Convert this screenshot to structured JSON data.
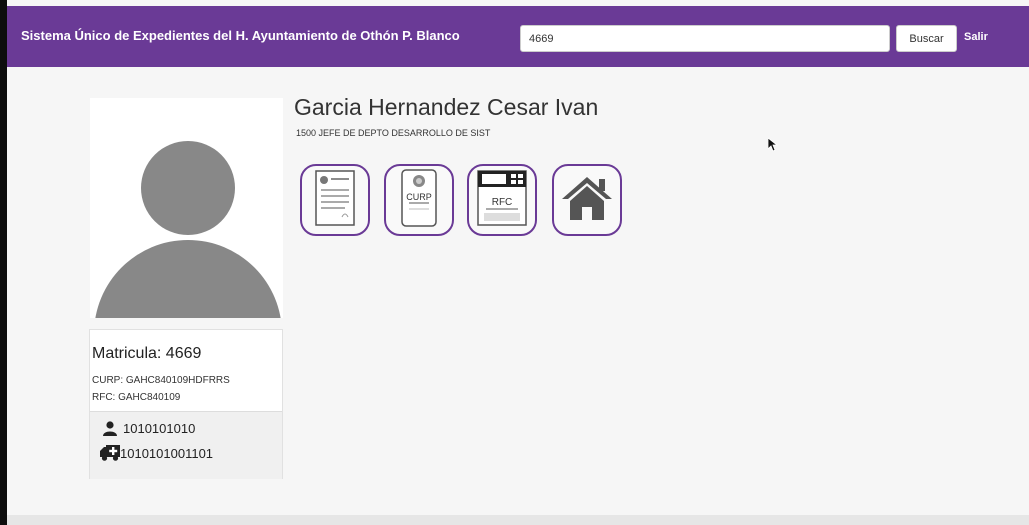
{
  "navbar": {
    "brand": "Sistema Único de Expedientes del H. Ayuntamiento de Othón P. Blanco",
    "search_value": "4669",
    "search_button": "Buscar",
    "logout": "Salir",
    "color": "#6a3a96"
  },
  "profile": {
    "name": "Garcia Hernandez Cesar Ivan",
    "position": "1500 JEFE DE DEPTO DESARROLLO DE SIST",
    "matricula": "Matricula: 4669",
    "curp": "CURP: GAHC840109HDFRRS",
    "rfc": "RFC: GAHC840109",
    "phone_icon": "user-icon",
    "phone": "1010101010",
    "nss_icon": "ambulance-icon",
    "nss": "1010101001101"
  },
  "documents": [
    {
      "icon": "document-icon"
    },
    {
      "icon": "curp-card-icon",
      "text": "CURP"
    },
    {
      "icon": "rfc-card-icon",
      "text": "RFC"
    },
    {
      "icon": "house-icon"
    }
  ]
}
